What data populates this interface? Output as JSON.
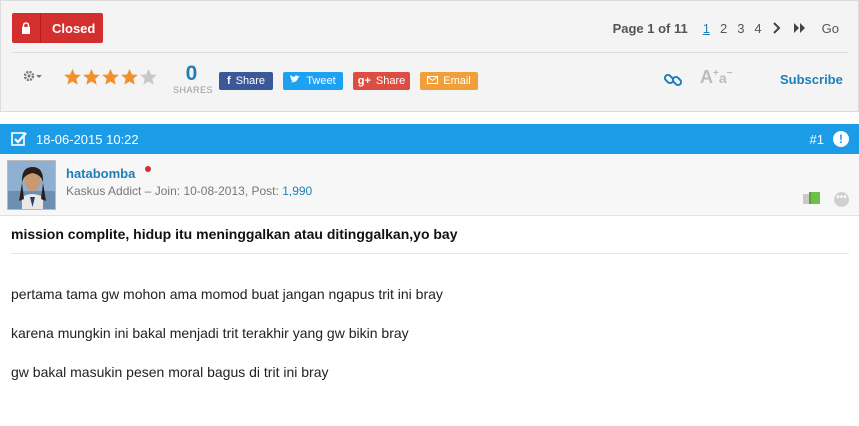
{
  "thread": {
    "status_label": "Closed",
    "pagination": {
      "info": "Page 1 of 11",
      "pages": [
        "1",
        "2",
        "3",
        "4"
      ],
      "current_page": "1",
      "go_label": "Go"
    },
    "rating": {
      "filled_stars": 4,
      "total_stars": 5
    },
    "shares": {
      "count": "0",
      "label": "SHARES"
    },
    "share_buttons": {
      "facebook": "Share",
      "twitter": "Tweet",
      "googleplus": "Share",
      "email": "Email"
    },
    "subscribe_label": "Subscribe"
  },
  "post": {
    "date": "18-06-2015 10:22",
    "number": "#1",
    "user": {
      "name": "hatabomba",
      "rank": "Kaskus Addict",
      "join_label": "Join:",
      "join_date": "10-08-2013",
      "post_label": "Post:",
      "post_count": "1,990"
    },
    "title": "mission complite, hidup itu meninggalkan atau ditinggalkan,yo bay",
    "body": [
      "pertama tama gw mohon ama momod buat jangan ngapus trit ini bray",
      "karena mungkin ini bakal menjadi trit terakhir yang gw bikin bray",
      "gw bakal masukin pesen moral bagus di trit ini bray"
    ]
  },
  "colors": {
    "closed": "#d32f2f",
    "post_bar": "#1c9be6",
    "link": "#1c7fb8",
    "star": "#f0912c"
  }
}
